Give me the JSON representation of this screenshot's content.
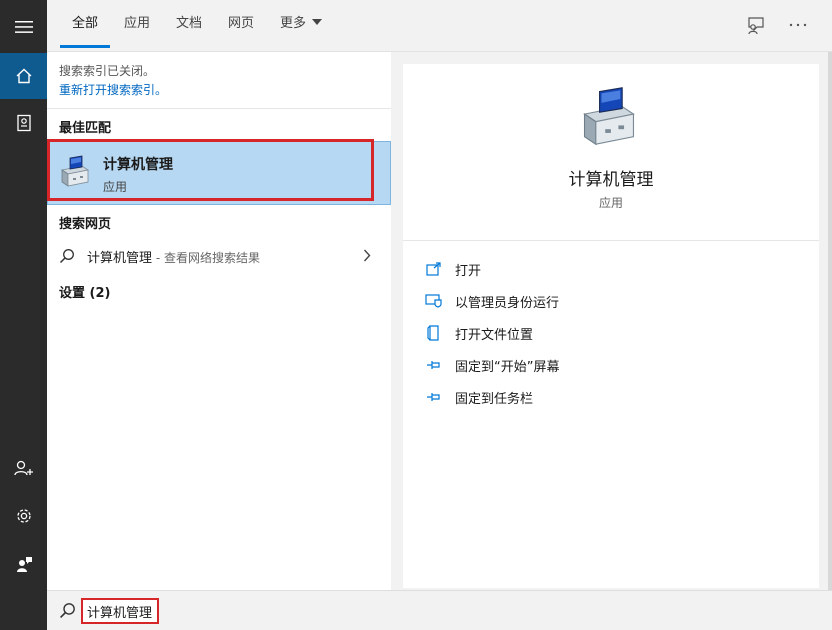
{
  "rail": {
    "items": [
      {
        "icon": "hamburger-menu-icon"
      },
      {
        "icon": "home-icon",
        "active": true
      },
      {
        "icon": "notebook-icon"
      },
      {
        "icon": "add-user-icon"
      },
      {
        "icon": "gear-icon"
      },
      {
        "icon": "feedback-icon"
      }
    ]
  },
  "tabs": [
    {
      "label": "全部",
      "active": true
    },
    {
      "label": "应用"
    },
    {
      "label": "文档"
    },
    {
      "label": "网页"
    },
    {
      "label": "更多"
    }
  ],
  "notice": {
    "text": "搜索索引已关闭。",
    "link": "重新打开搜索索引。"
  },
  "best_match": {
    "heading": "最佳匹配",
    "title": "计算机管理",
    "subtitle": "应用"
  },
  "web_search": {
    "heading": "搜索网页",
    "query": "计算机管理",
    "hint": " - 查看网络搜索结果"
  },
  "settings": {
    "heading": "设置 (2)"
  },
  "detail": {
    "title": "计算机管理",
    "subtitle": "应用",
    "actions": [
      {
        "label": "打开",
        "icon": "open-icon"
      },
      {
        "label": "以管理员身份运行",
        "icon": "shield-admin-icon"
      },
      {
        "label": "打开文件位置",
        "icon": "file-location-icon"
      },
      {
        "label": "固定到“开始”屏幕",
        "icon": "pin-icon"
      },
      {
        "label": "固定到任务栏",
        "icon": "pin-taskbar-icon"
      }
    ]
  },
  "search": {
    "value": "计算机管理"
  },
  "colors": {
    "accent": "#0078d7",
    "selection": "#b7d8f2",
    "highlight_border": "#d6262a",
    "rail": "#2b2b2b"
  }
}
